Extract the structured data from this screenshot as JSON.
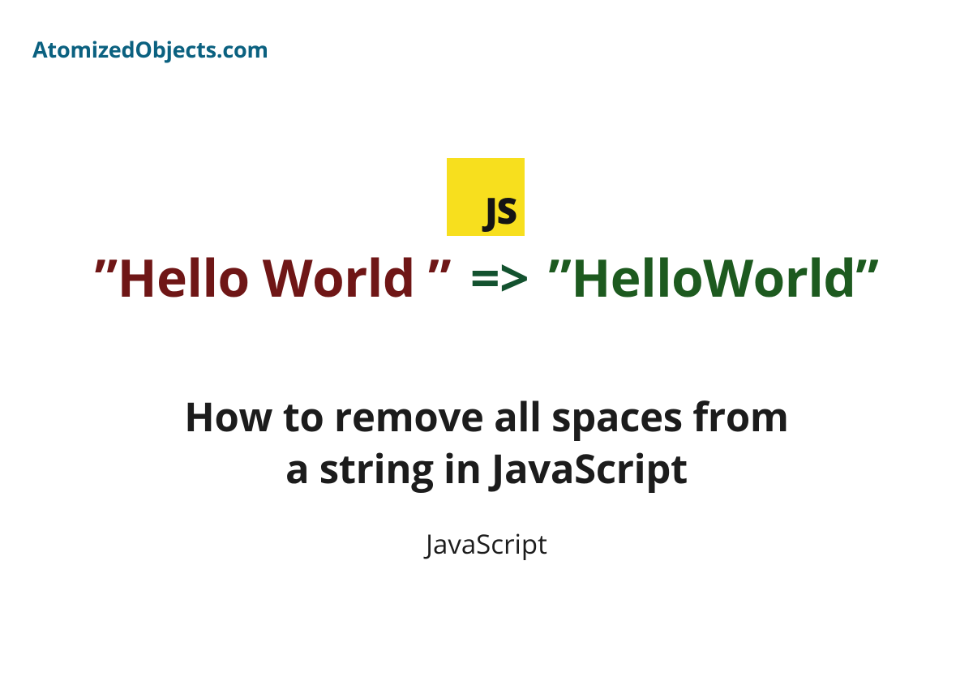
{
  "brand": "AtomizedObjects.com",
  "badge": "JS",
  "example": {
    "input": "”Hello World ”",
    "arrow": "=>",
    "output": "”HelloWorld”"
  },
  "headline_line1": "How to remove all spaces from",
  "headline_line2": "a string in JavaScript",
  "category": "JavaScript"
}
